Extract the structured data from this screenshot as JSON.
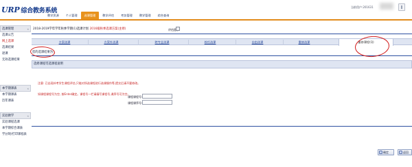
{
  "header": {
    "logo_main": "URP",
    "logo_sub": "综合教务系统",
    "nav_tabs": [
      "教学资源",
      "个人管理",
      "选课管理",
      "教学评估",
      "考务管理",
      "教学管理",
      "综合查询"
    ],
    "active_tab_index": 2,
    "user_label": "当前用户:201631",
    "accent_color": "#e28a1a"
  },
  "sidebar": {
    "sections": [
      {
        "title": "选课管理",
        "items": [
          "选课公告",
          "网上选课",
          "选课结果",
          "退课",
          "无效选课结果"
        ],
        "active_item_index": 1
      },
      {
        "title": "本学期课表",
        "items": [
          "本学期课表",
          "历年课表"
        ]
      },
      {
        "title": "实验教学",
        "items": [
          "实验课程选课",
          "本学期综合课表",
          "学分制/打印课程表"
        ]
      }
    ],
    "collapse_glyph": "«"
  },
  "content": {
    "semester_title": "2018-2019学年学年秋季学期(1)选课计划",
    "plan_link": "2016级秋季选课方案(主修)",
    "note_label": "评估提示",
    "note_icon": "notice-icon",
    "sub_tabs": [
      "方案选课",
      "方案外选课",
      "跨专业选课",
      "校任选课",
      "自由选课",
      "重修选课",
      "重修课程(Q)"
    ],
    "active_sub_tab_index": 6,
    "selected_courses_label": "您的选课结果为:",
    "table_header": "选修课程可选课程说明",
    "warning_line1": "注意: 已出现补考学生课程评估,只能对所选课程进行选课操作等,提交后请不要修改。",
    "warning_line2": "如课程课程号为空, 按Enter确定。课程号一栏请填写课程号,课序号可为空。",
    "course_no_label": "课程课程号:",
    "seq_no_label": "课程课序号:",
    "course_no_value": "",
    "seq_no_value": ""
  },
  "actions": {
    "confirm_label": "确定",
    "back_label": "返回"
  },
  "annotation_color": "#d11a1a"
}
